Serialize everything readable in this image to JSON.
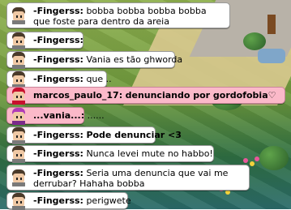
{
  "chat": {
    "messages": [
      {
        "user": "-Fingerss:",
        "text": "bobba bobba bobba bobba que foste para dentro da areia",
        "style": "white"
      },
      {
        "user": "-Fingerss:",
        "text": "",
        "style": "white"
      },
      {
        "user": "-Fingerss:",
        "text": "Vania es tão ghworda",
        "style": "white"
      },
      {
        "user": "-Fingerss:",
        "text": "que ..",
        "style": "white"
      },
      {
        "user": "marcos_paulo_17:",
        "text": "denunciando por gordofobia♡",
        "style": "pink",
        "bold_text": true
      },
      {
        "user": "...vania...:",
        "text": "......",
        "style": "pink"
      },
      {
        "user": "-Fingerss:",
        "text": "Pode denunciar <3",
        "style": "white",
        "bold_text": true
      },
      {
        "user": "-Fingerss:",
        "text": "Nunca levei mute no habbo!",
        "style": "white"
      },
      {
        "user": "-Fingerss:",
        "text": "Seria uma denuncia que vai me derrubar? Hahaha bobba",
        "style": "white"
      },
      {
        "user": "-Fingerss:",
        "text": "perigwete",
        "style": "white"
      }
    ]
  },
  "colors": {
    "bubble_white": "#ffffff",
    "bubble_pink": "#fbb9c9",
    "avatar_red": "#c8102e",
    "avatar_purple": "#b03ab8"
  }
}
